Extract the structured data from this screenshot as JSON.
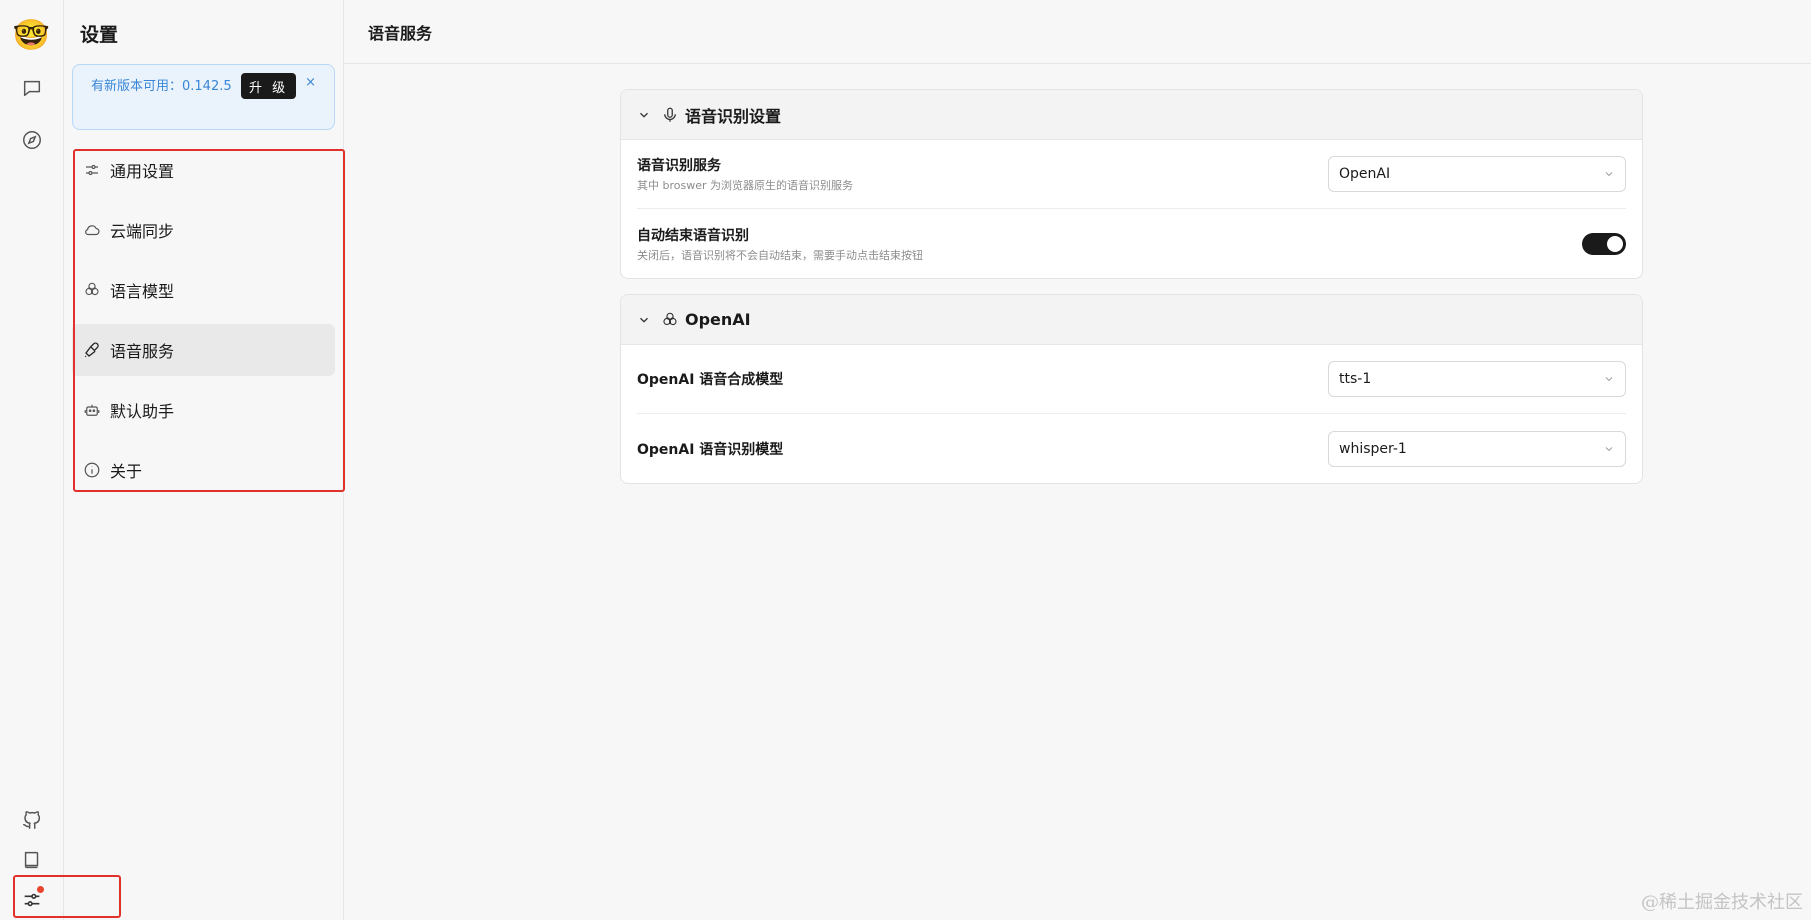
{
  "app": {
    "avatar_emoji": "🤓"
  },
  "rail": {
    "icons": [
      "chat-icon",
      "discover-icon",
      "github-icon",
      "docs-icon",
      "settings-icon"
    ]
  },
  "sidebar": {
    "title": "设置",
    "update_banner": {
      "message": "有新版本可用：0.142.5",
      "upgrade_label": "升 级",
      "close_label": "×"
    },
    "items": [
      {
        "label": "通用设置",
        "icon": "sliders-icon"
      },
      {
        "label": "云端同步",
        "icon": "cloud-icon"
      },
      {
        "label": "语言模型",
        "icon": "openai-icon"
      },
      {
        "label": "语音服务",
        "icon": "microphone-icon",
        "active": true
      },
      {
        "label": "默认助手",
        "icon": "robot-icon"
      },
      {
        "label": "关于",
        "icon": "info-icon"
      }
    ]
  },
  "main": {
    "header_title": "语音服务",
    "sections": [
      {
        "title": "语音识别设置",
        "rows": [
          {
            "label": "语音识别服务",
            "desc": "其中 broswer 为浏览器原生的语音识别服务",
            "value": "OpenAI"
          },
          {
            "label": "自动结束语音识别",
            "desc": "关闭后，语音识别将不会自动结束，需要手动点击结束按钮",
            "toggle_on": true
          }
        ]
      },
      {
        "title": "OpenAI",
        "rows": [
          {
            "label": "OpenAI 语音合成模型",
            "value": "tts-1"
          },
          {
            "label": "OpenAI 语音识别模型",
            "value": "whisper-1"
          }
        ]
      }
    ]
  },
  "watermark": "@稀土掘金技术社区",
  "colors": {
    "accent": "#3a86d6",
    "highlight_box": "#e0322b",
    "dark": "#1a1a1a"
  }
}
